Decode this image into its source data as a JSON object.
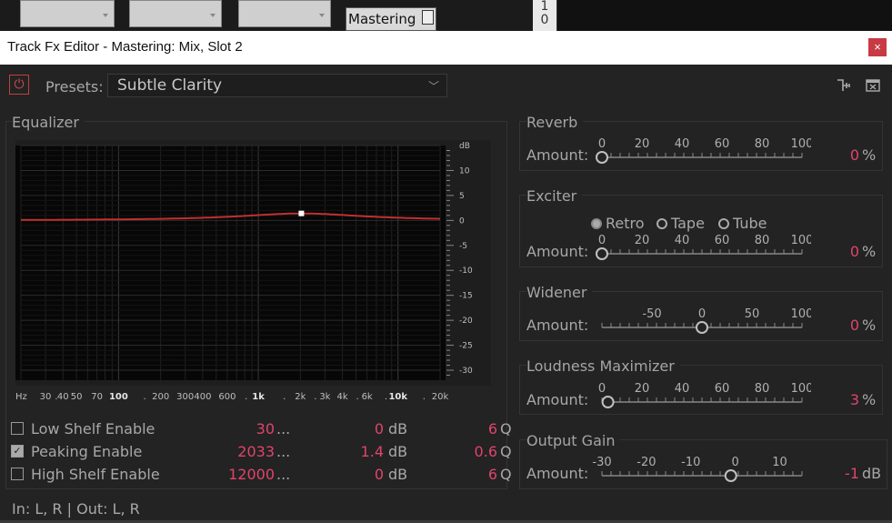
{
  "topstrip": {
    "track_slot_label": "Mastering",
    "ruler_numbers": [
      "1",
      "0"
    ]
  },
  "window": {
    "title": "Track Fx Editor - Mastering: Mix, Slot 2",
    "close_glyph": "×"
  },
  "toolbar": {
    "presets_label": "Presets:",
    "preset_value": "Subtle Clarity"
  },
  "equalizer": {
    "title": "Equalizer",
    "db_axis": {
      "unit": "dB",
      "ticks": [
        10,
        5,
        0,
        -5,
        -10,
        -15,
        -20,
        -25,
        -30
      ],
      "range": [
        -32,
        15
      ]
    },
    "freq_axis": {
      "unit": "Hz",
      "labels": [
        "30",
        "40",
        "50",
        "70",
        "100",
        "200",
        "300",
        "400",
        "600",
        "1k",
        "2k",
        "3k",
        "4k",
        "6k",
        "10k",
        "20k"
      ]
    },
    "curve_point": {
      "freq": 2033,
      "gain_db": 1.4
    },
    "rows": [
      {
        "label": "Low Shelf Enable",
        "checked": false,
        "freq": "30",
        "freq_suffix": "...",
        "gain": "0",
        "gain_unit": "dB",
        "q": "6",
        "q_unit": "Q"
      },
      {
        "label": "Peaking Enable",
        "checked": true,
        "freq": "2033",
        "freq_suffix": "...",
        "gain": "1.4",
        "gain_unit": "dB",
        "q": "0.6",
        "q_unit": "Q"
      },
      {
        "label": "High Shelf Enable",
        "checked": false,
        "freq": "12000",
        "freq_suffix": "...",
        "gain": "0",
        "gain_unit": "dB",
        "q": "6",
        "q_unit": "Q"
      }
    ]
  },
  "reverb": {
    "title": "Reverb",
    "amount_label": "Amount:",
    "scale": [
      "0",
      "20",
      "40",
      "60",
      "80",
      "100"
    ],
    "value": "0",
    "unit": "%",
    "min": 0,
    "max": 100,
    "level": 0
  },
  "exciter": {
    "title": "Exciter",
    "modes": [
      "Retro",
      "Tape",
      "Tube"
    ],
    "selected_mode": "Retro",
    "amount_label": "Amount:",
    "scale": [
      "0",
      "20",
      "40",
      "60",
      "80",
      "100"
    ],
    "value": "0",
    "unit": "%",
    "min": 0,
    "max": 100,
    "level": 0
  },
  "widener": {
    "title": "Widener",
    "amount_label": "Amount:",
    "scale": [
      "-50",
      "0",
      "50",
      "100"
    ],
    "value": "0",
    "unit": "%",
    "min": -100,
    "max": 100,
    "level": 0
  },
  "loudness": {
    "title": "Loudness Maximizer",
    "amount_label": "Amount:",
    "scale": [
      "0",
      "20",
      "40",
      "60",
      "80",
      "100"
    ],
    "value": "3",
    "unit": "%",
    "min": 0,
    "max": 100,
    "level": 3
  },
  "output_gain": {
    "title": "Output Gain",
    "amount_label": "Amount:",
    "scale": [
      "-30",
      "-20",
      "-10",
      "0",
      "10"
    ],
    "value": "-1",
    "unit": "dB",
    "min": -30,
    "max": 15,
    "level": -1
  },
  "io": {
    "text": "In: L, R | Out: L, R"
  },
  "colors": {
    "accent": "#e0446c",
    "curve": "#c03030",
    "background": "#232323",
    "graph_bg": "#070707"
  }
}
